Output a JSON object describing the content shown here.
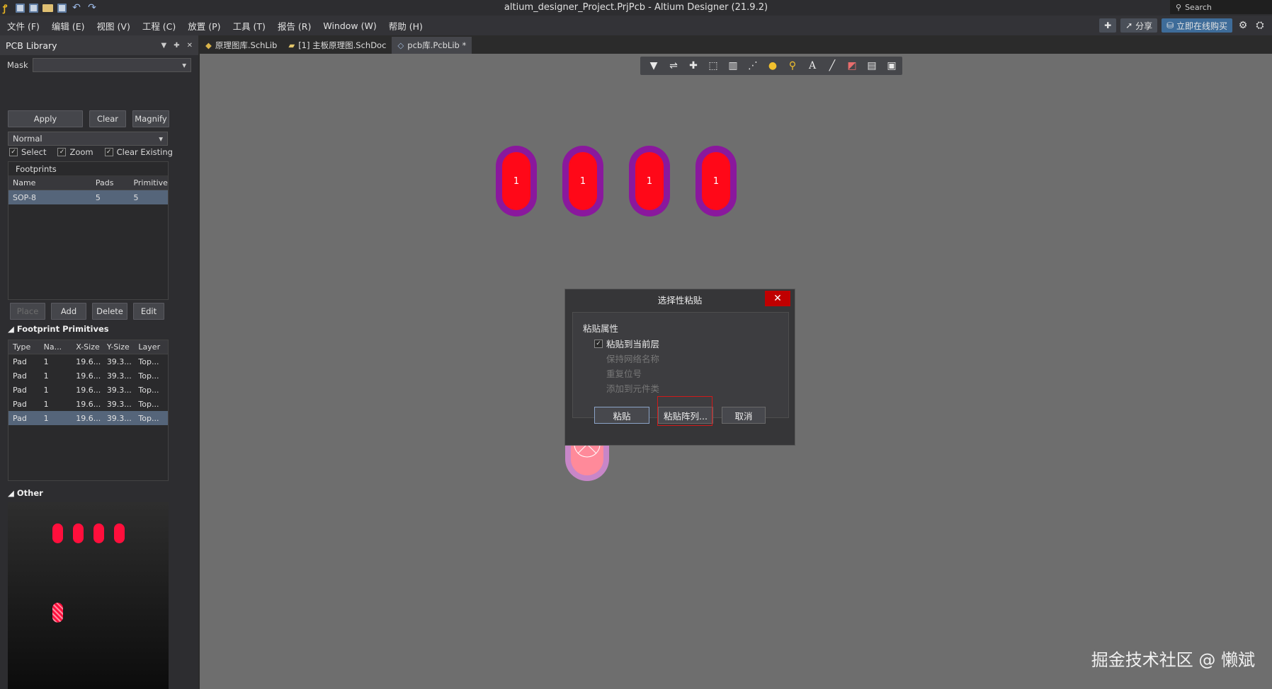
{
  "window": {
    "title": "altium_designer_Project.PrjPcb - Altium Designer (21.9.2)",
    "search_placeholder": "Search"
  },
  "menu": {
    "items": [
      "文件 (F)",
      "编辑 (E)",
      "视图 (V)",
      "工程 (C)",
      "放置 (P)",
      "工具 (T)",
      "报告 (R)",
      "Window (W)",
      "帮助 (H)"
    ],
    "share_label": "分享",
    "buy_label": "立即在线购买"
  },
  "panel": {
    "title": "PCB Library",
    "mask_label": "Mask",
    "mask_value": "",
    "apply_label": "Apply",
    "clear_label": "Clear",
    "magnify_label": "Magnify",
    "mode_value": "Normal",
    "select_label": "Select",
    "zoom_label": "Zoom",
    "clear_existing_label": "Clear Existing",
    "footprints_title": "Footprints",
    "footprint_columns": [
      "Name",
      "Pads",
      "Primitives"
    ],
    "footprint_rows": [
      {
        "name": "SOP-8",
        "pads": "5",
        "primitives": "5"
      }
    ],
    "place_label": "Place",
    "add_label": "Add",
    "delete_label": "Delete",
    "edit_label": "Edit",
    "primitives_title": "Footprint Primitives",
    "primitive_columns": [
      "Type",
      "Na...",
      "X-Size",
      "Y-Size",
      "Layer"
    ],
    "primitive_rows": [
      {
        "type": "Pad",
        "name": "1",
        "x": "19.6...",
        "y": "39.3...",
        "layer": "Top..."
      },
      {
        "type": "Pad",
        "name": "1",
        "x": "19.6...",
        "y": "39.3...",
        "layer": "Top..."
      },
      {
        "type": "Pad",
        "name": "1",
        "x": "19.6...",
        "y": "39.3...",
        "layer": "Top..."
      },
      {
        "type": "Pad",
        "name": "1",
        "x": "19.6...",
        "y": "39.3...",
        "layer": "Top..."
      },
      {
        "type": "Pad",
        "name": "1",
        "x": "19.6...",
        "y": "39.3...",
        "layer": "Top..."
      }
    ],
    "other_title": "Other"
  },
  "tabs": [
    {
      "label": "原理图库.SchLib"
    },
    {
      "label": "[1] 主板原理图.SchDoc"
    },
    {
      "label": "pcb库.PcbLib *"
    }
  ],
  "canvas": {
    "pad_label": "1"
  },
  "dialog": {
    "title": "选择性粘贴",
    "group_label": "粘贴属性",
    "opt_current_layer": "粘贴到当前层",
    "opt_keep_net": "保持网络名称",
    "opt_dup_designator": "重复位号",
    "opt_add_class": "添加到元件类",
    "paste_label": "粘贴",
    "paste_array_label": "粘贴阵列...",
    "cancel_label": "取消"
  },
  "watermark": "掘金技术社区 @ 懒斌",
  "colors": {
    "pad_ring": "#8a189d",
    "pad_core": "#ff0818",
    "close_button": "#c00000",
    "highlight_box": "#d11a1a"
  }
}
